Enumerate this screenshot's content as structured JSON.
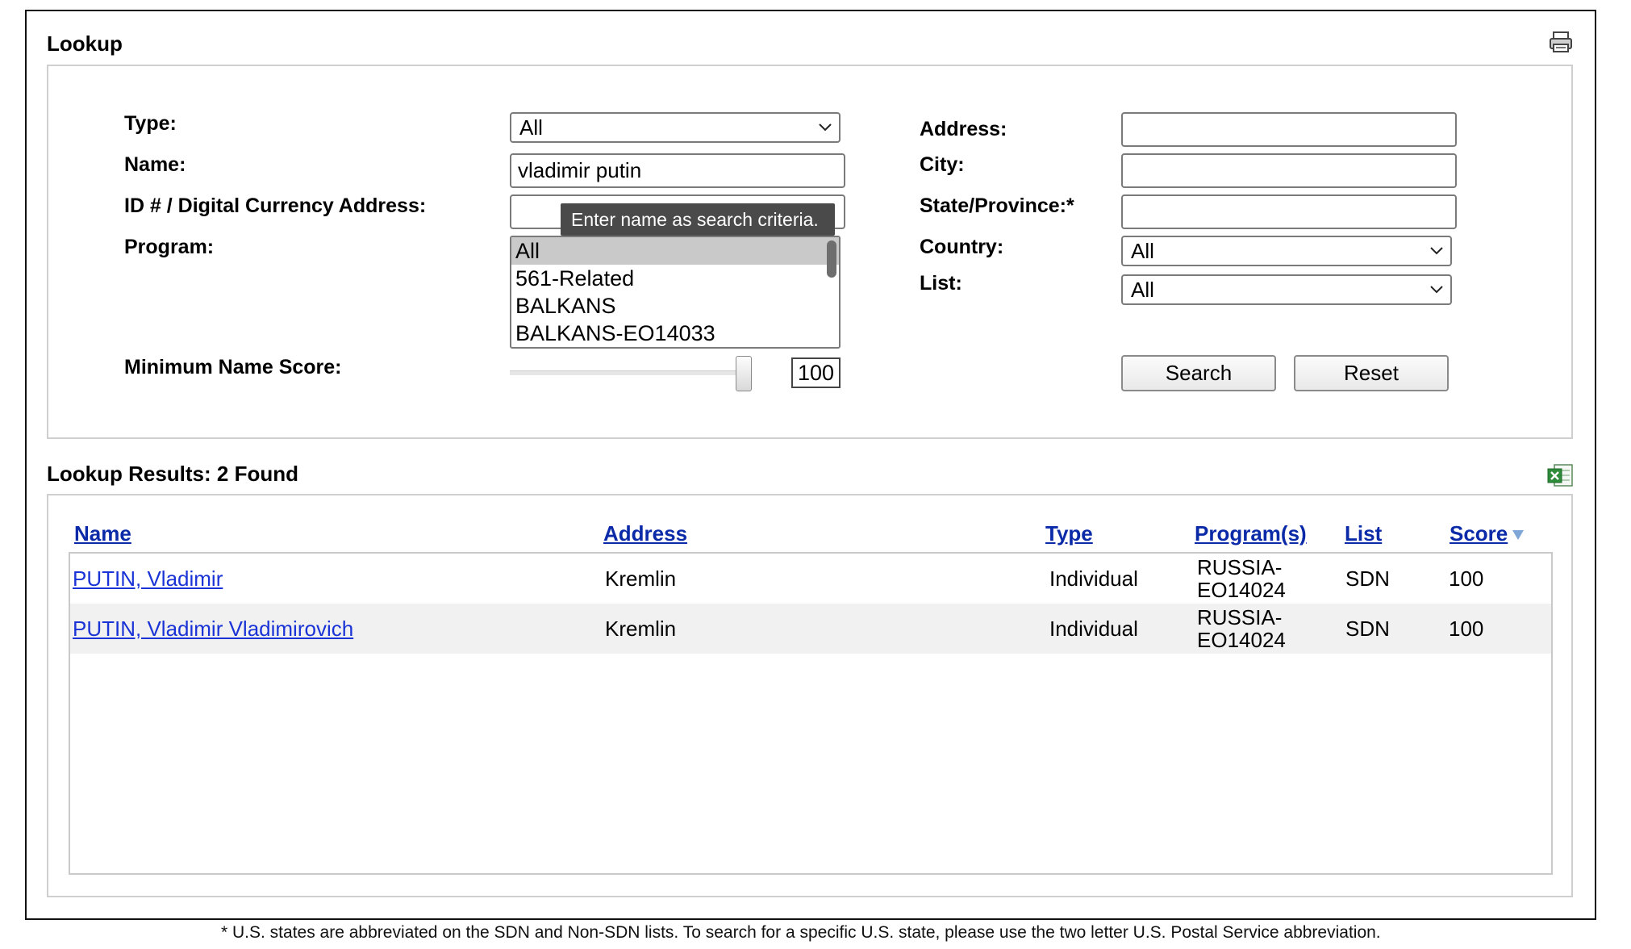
{
  "lookup": {
    "title": "Lookup",
    "labels": {
      "type": "Type:",
      "name": "Name:",
      "id": "ID # / Digital Currency Address:",
      "program": "Program:",
      "min_score": "Minimum Name Score:",
      "address": "Address:",
      "city": "City:",
      "state": "State/Province:*",
      "country": "Country:",
      "list": "List:"
    },
    "type_value": "All",
    "name_value": "vladimir putin",
    "id_value": "",
    "address_value": "",
    "city_value": "",
    "state_value": "",
    "country_value": "All",
    "list_value": "All",
    "program_options": [
      "All",
      "561-Related",
      "BALKANS",
      "BALKANS-EO14033"
    ],
    "program_selected": "All",
    "tooltip": "Enter name as search criteria.",
    "min_score_value": "100",
    "min_score_level": 100,
    "search_label": "Search",
    "reset_label": "Reset"
  },
  "results": {
    "title": "Lookup Results: 2 Found",
    "columns": [
      "Name",
      "Address",
      "Type",
      "Program(s)",
      "List",
      "Score"
    ],
    "sort_column": "Score",
    "rows": [
      {
        "name": "PUTIN, Vladimir",
        "address": "Kremlin",
        "type": "Individual",
        "program_line1": "RUSSIA-",
        "program_line2": "EO14024",
        "list": "SDN",
        "score": "100"
      },
      {
        "name": "PUTIN, Vladimir Vladimirovich",
        "address": "Kremlin",
        "type": "Individual",
        "program_line1": "RUSSIA-",
        "program_line2": "EO14024",
        "list": "SDN",
        "score": "100"
      }
    ]
  },
  "footnote": "* U.S. states are abbreviated on the SDN and Non-SDN lists. To search for a specific U.S. state, please use the two letter U.S. Postal Service abbreviation.",
  "icons": {
    "print": "print-icon",
    "excel": "excel-export-icon",
    "sort": "sort-desc-icon"
  },
  "colors": {
    "link": "#1a33d6",
    "header_link": "#0b2aa8",
    "tooltip_bg": "#4a4a4a",
    "row_alt": "#f1f1f1"
  }
}
